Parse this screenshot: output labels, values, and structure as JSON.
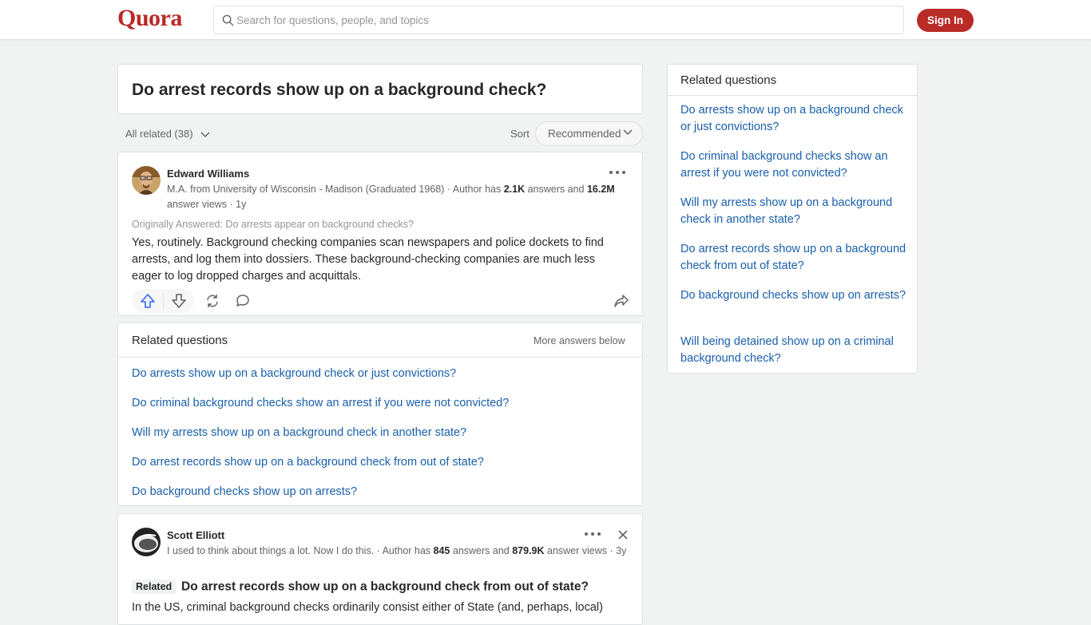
{
  "header": {
    "logo": "Quora",
    "search_placeholder": "Search for questions, people, and topics",
    "signin_label": "Sign In"
  },
  "question": {
    "title": "Do arrest records show up on a background check?"
  },
  "filters": {
    "all_related": "All related (38)",
    "sort_label": "Sort",
    "sort_value": "Recommended"
  },
  "answer1": {
    "author": "Edward Williams",
    "cred_prefix": "M.A. from University of Wisconsin - Madison (Graduated 1968) · Author has ",
    "answers_count": "2.1K",
    "cred_middle": " answers and ",
    "views_count": "16.2M",
    "cred_suffix": " answer views · 1y",
    "originally_answered": "Originally Answered: Do arrests appear on background checks?",
    "body": "Yes, routinely. Background checking companies scan newspapers and police dockets to find arrests, and log them into dossiers. These background-checking companies are much less eager to log dropped charges and acquittals."
  },
  "related_inline": {
    "title": "Related questions",
    "more": "More answers below",
    "items": [
      "Do arrests show up on a background check or just convictions?",
      "Do criminal background checks show an arrest if you were not convicted?",
      "Will my arrests show up on a background check in another state?",
      "Do arrest records show up on a background check from out of state?",
      "Do background checks show up on arrests?"
    ]
  },
  "answer2": {
    "author": "Scott Elliott",
    "cred_prefix": "I used to think about things a lot. Now I do this. · Author has ",
    "answers_count": "845",
    "cred_middle": " answers and ",
    "views_count": "879.9K",
    "cred_suffix": " answer views · 3y",
    "related_badge": "Related",
    "related_title": "Do arrest records show up on a background check from out of state?",
    "body": "In the US, criminal background checks ordinarily consist either of State (and, perhaps, local)"
  },
  "sidebar": {
    "title": "Related questions",
    "items": [
      "Do arrests show up on a background check or just convictions?",
      "Do criminal background checks show an arrest if you were not convicted?",
      "Will my arrests show up on a background check in another state?",
      "Do arrest records show up on a background check from out of state?",
      "Do background checks show up on arrests?",
      "Will being detained show up on a criminal background check?"
    ]
  },
  "colors": {
    "brand": "#b92b27",
    "link": "#195faa",
    "upvote": "#2e69ff"
  }
}
